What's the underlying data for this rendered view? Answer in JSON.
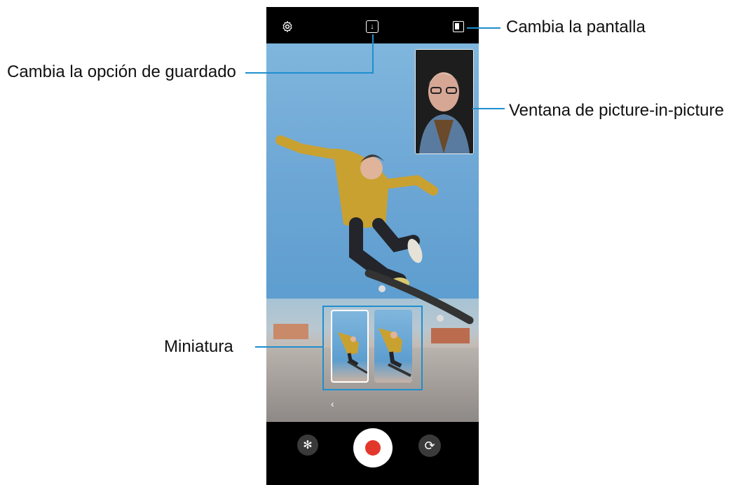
{
  "callouts": {
    "change_screen": "Cambia la pantalla",
    "save_option": "Cambia la opción de guardado",
    "pip_window": "Ventana de picture-in-picture",
    "thumbnail": "Miniatura"
  },
  "colors": {
    "callout_line": "#1e8fcf",
    "record": "#e2382b",
    "sky": "#6ba5d4"
  },
  "icons": {
    "settings": "⚙",
    "save_option": "↓",
    "effects": "✻",
    "switch_camera": "⟳",
    "back_chevron": "‹"
  }
}
